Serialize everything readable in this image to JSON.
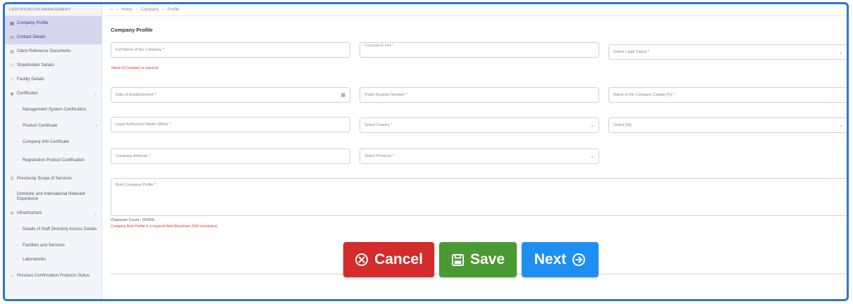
{
  "sidebar": {
    "title": "CERTIFICATION MANAGEMENT",
    "items": [
      {
        "label": "Company Profile",
        "icon": "building-icon",
        "active": true
      },
      {
        "label": "Contact Details",
        "icon": "phone-icon",
        "active": true
      },
      {
        "label": "Client Reference Documents",
        "icon": "doc-icon"
      },
      {
        "label": "Shareholder Details",
        "icon": "users-icon"
      },
      {
        "label": "Facility Details",
        "icon": "home-icon"
      },
      {
        "label": "Certificates",
        "icon": "certificate-icon"
      }
    ],
    "sub_items": [
      {
        "label": "Management System Certification",
        "icon": "doc-icon"
      },
      {
        "label": "Product Certificate",
        "icon": "doc-icon"
      },
      {
        "label": "Company Info Certificate",
        "icon": "doc-icon"
      },
      {
        "label": "Registration Product Certification",
        "icon": "doc-icon"
      }
    ],
    "more": [
      {
        "label": "Previously Scope of Services",
        "icon": "list-icon"
      },
      {
        "label": "Domestic and International Relevant Experience",
        "icon": "globe-icon"
      },
      {
        "label": "Infrastructure",
        "icon": "gear-icon"
      }
    ],
    "infra_sub": [
      {
        "label": "Details of Staff Directory Access Details",
        "icon": "doc-icon"
      },
      {
        "label": "Facilities and Services",
        "icon": "doc-icon"
      },
      {
        "label": "Laboratories",
        "icon": "doc-icon"
      }
    ],
    "last": {
      "label": "Previous Confirmation Products Status",
      "icon": "check-icon"
    }
  },
  "breadcrumb": [
    "Home",
    "Company",
    "Profile"
  ],
  "page_title": "Company Profile",
  "form": {
    "company_name": "Full Name of the Company *",
    "company_name_error": "Name of Company is required",
    "corporate_email": "Corporate E-mail *",
    "legal_status": "Select Legal Status *",
    "date_establishment": "Date of Establishment *",
    "trade_register": "Trade Register Number *",
    "tax_number": "Name of the Company Capital (%) *",
    "legal_officer": "Legal Authorized Media Officer *",
    "country": "Select Country *",
    "city": "Select City",
    "company_address": "Company Address *",
    "province": "Select Province *",
    "brief_profile": "Brief Company Profile *",
    "char_count": "Character Count : 0/2000",
    "profile_error": "Company Brief Profile is a required field (Maximum 2000 characters)"
  },
  "buttons": {
    "cancel": "Cancel",
    "save": "Save",
    "next": "Next"
  },
  "colors": {
    "cancel": "#d42b2b",
    "save": "#4a9a33",
    "next": "#1e8ff0",
    "frame": "#2f75c7",
    "active_sidebar": "#d7d6ee",
    "error": "#e0393c"
  }
}
